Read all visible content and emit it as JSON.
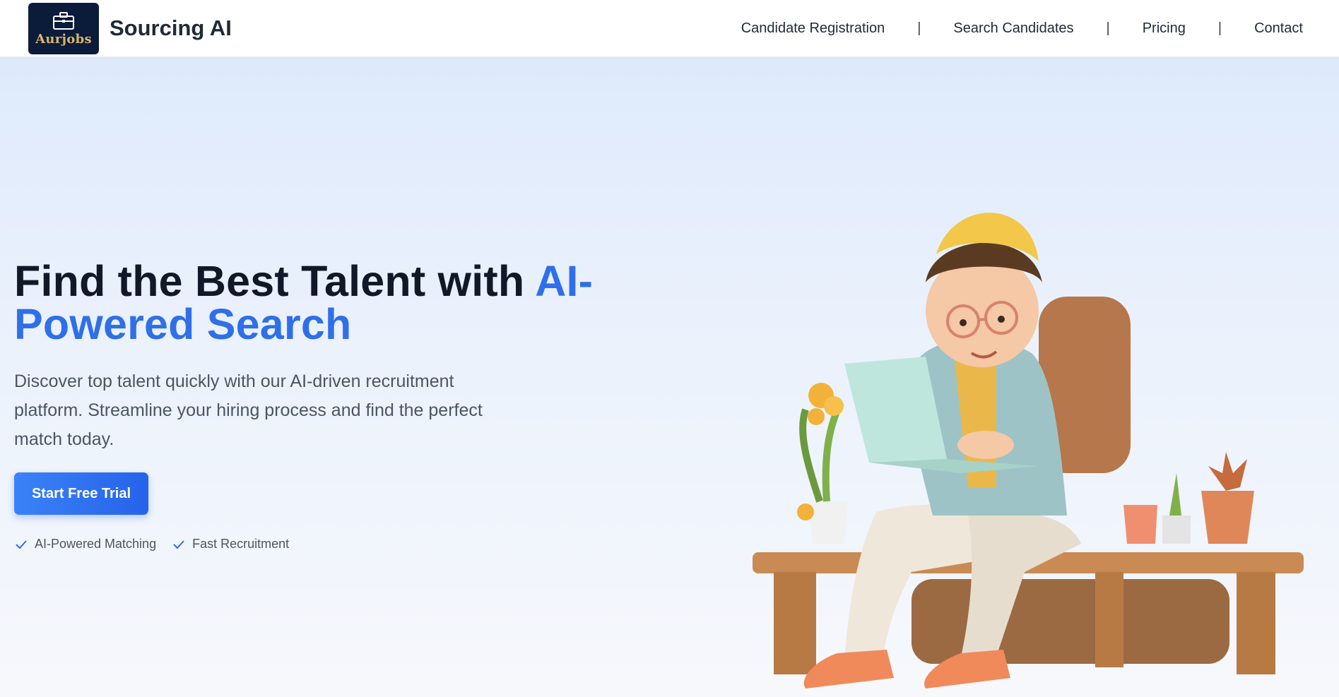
{
  "header": {
    "logo_text": "Aurjobs",
    "brand": "Sourcing AI",
    "nav": [
      {
        "label": "Candidate Registration"
      },
      {
        "label": "Search Candidates"
      },
      {
        "label": "Pricing"
      },
      {
        "label": "Contact"
      }
    ],
    "separator": "|"
  },
  "hero": {
    "title_prefix": "Find the Best Talent with ",
    "title_accent": "AI-Powered Search",
    "description": "Discover top talent quickly with our AI-driven recruitment platform. Streamline your hiring process and find the perfect match today.",
    "cta_label": "Start Free Trial",
    "features": [
      {
        "label": "AI-Powered Matching",
        "icon": "check-icon"
      },
      {
        "label": "Fast Recruitment",
        "icon": "check-icon"
      }
    ]
  },
  "colors": {
    "accent": "#2f6fe8",
    "button": "#2563eb",
    "logo_bg": "#0b1b3a",
    "logo_text": "#d9b66a"
  }
}
